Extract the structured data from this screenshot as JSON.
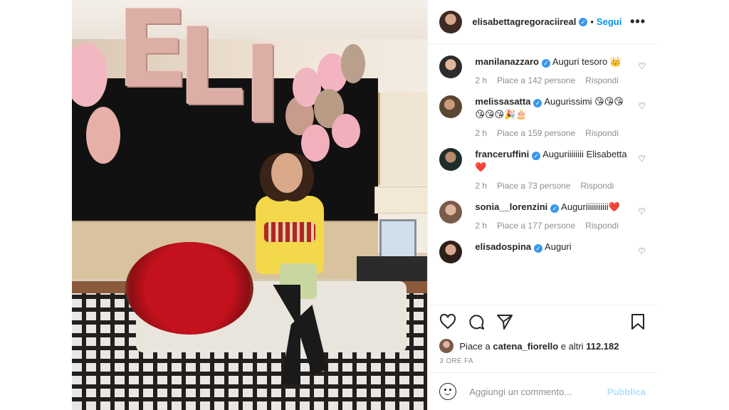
{
  "post": {
    "author": "elisabettagregoraciireal",
    "follow_label": "Segui",
    "separator": "•",
    "more_icon": "more-horizontal-icon"
  },
  "photo": {
    "balloon_letters": [
      "E",
      "L",
      "I"
    ],
    "accent_colors": {
      "balloon_rose": "#dcaea5",
      "roses": "#c3121d",
      "top": "#f2d84a"
    }
  },
  "comments": [
    {
      "user": "manilanazzaro",
      "verified": true,
      "text": "Auguri tesoro 👑",
      "time": "2 h",
      "likes": "Piace a 142 persone",
      "reply": "Rispondi"
    },
    {
      "user": "melissasatta",
      "verified": true,
      "text": "Augurissimi 😘😘😘 😘😘😘🎉🎂",
      "time": "2 h",
      "likes": "Piace a 159 persone",
      "reply": "Rispondi"
    },
    {
      "user": "franceruffini",
      "verified": true,
      "text": "Auguriiiiiiii Elisabetta ❤️",
      "time": "2 h",
      "likes": "Piace a 73 persone",
      "reply": "Rispondi"
    },
    {
      "user": "sonia__lorenzini",
      "verified": true,
      "text": "Auguriiiiiiiiiii❤️",
      "time": "2 h",
      "likes": "Piace a 177 persone",
      "reply": "Rispondi"
    },
    {
      "user": "elisadospina",
      "verified": true,
      "text": "Auguri",
      "time": "",
      "likes": "",
      "reply": ""
    }
  ],
  "actions": {
    "like_icon": "heart-icon",
    "comment_icon": "comment-icon",
    "share_icon": "share-icon",
    "save_icon": "bookmark-icon"
  },
  "likes_summary": {
    "prefix": "Piace a",
    "user": "catena_fiorello",
    "suffix": "e altri",
    "count": "112.182"
  },
  "posted_ago": "3 ORE FA",
  "comment_box": {
    "placeholder": "Aggiungi un commento...",
    "publish_label": "Pubblica"
  }
}
